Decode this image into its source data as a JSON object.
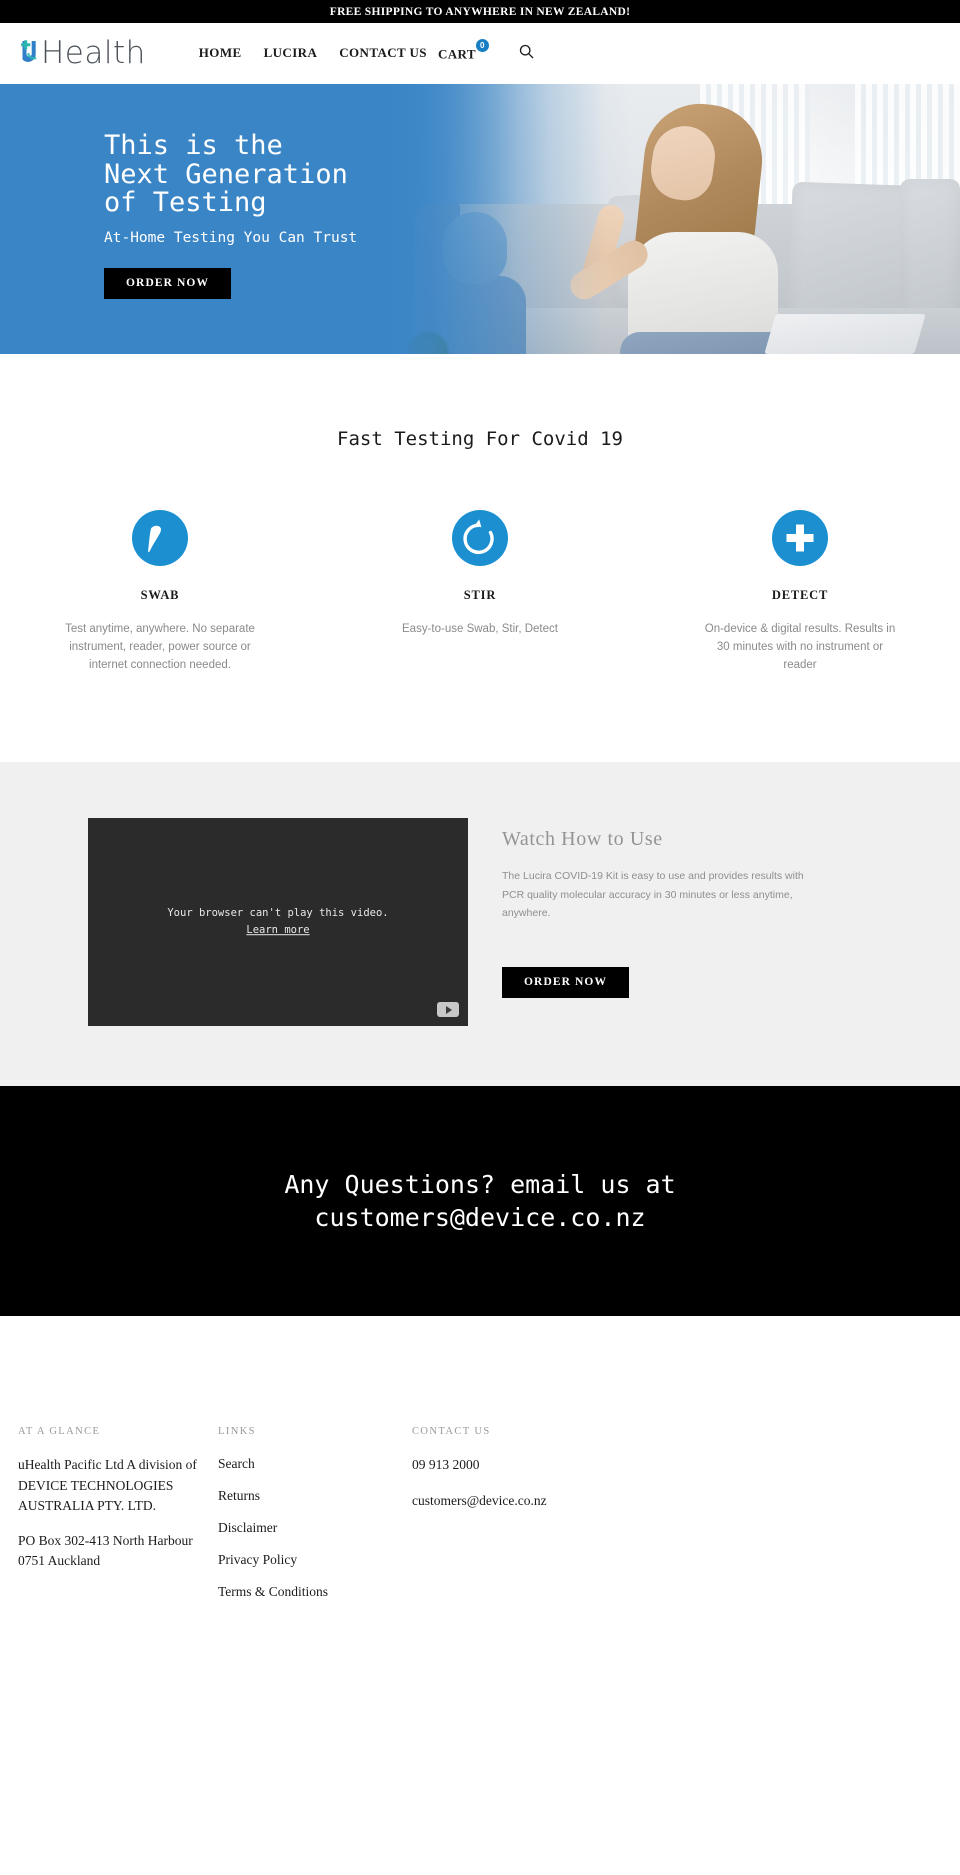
{
  "announcement": {
    "text": "FREE SHIPPING TO ANYWHERE IN NEW ZEALAND!"
  },
  "header": {
    "logo_text": "Health",
    "nav": [
      {
        "label": "HOME"
      },
      {
        "label": "LUCIRA"
      },
      {
        "label": "CONTACT US"
      }
    ],
    "cart_label": "CART",
    "cart_count": "0",
    "search_icon": "search-icon",
    "accent_color": "#1b7fc4"
  },
  "hero": {
    "title": "This is the Next Generation of Testing",
    "subtitle": "At-Home Testing You Can Trust",
    "cta_label": "ORDER NOW",
    "background_color": "#3a85c6"
  },
  "features": {
    "heading": "Fast Testing For Covid 19",
    "icon_color": "#1b8fd0",
    "items": [
      {
        "icon": "swab-icon",
        "title": "SWAB",
        "text": "Test anytime, anywhere. No separate instrument, reader, power source or internet connection needed."
      },
      {
        "icon": "stir-arrow-icon",
        "title": "STIR",
        "text": "Easy-to-use Swab, Stir, Detect"
      },
      {
        "icon": "plus-cross-icon",
        "title": "DETECT",
        "text": "On-device & digital results. Results in 30 minutes with no instrument or reader"
      }
    ]
  },
  "video_section": {
    "player_message": "Your browser can't play this video.",
    "player_link": "Learn more",
    "heading": "Watch How to Use",
    "body": "The Lucira COVID-19 Kit is easy to use and provides results with PCR quality molecular accuracy in 30 minutes or less anytime, anywhere.",
    "cta_label": "ORDER NOW"
  },
  "email_cta": {
    "line1": "Any Questions? email us at",
    "line2": "customers@device.co.nz"
  },
  "footer": {
    "columns": [
      {
        "heading": "AT A GLANCE",
        "paragraphs": [
          "uHealth Pacific Ltd A division of DEVICE TECHNOLOGIES AUSTRALIA PTY. LTD.",
          "PO Box 302-413 North Harbour 0751 Auckland"
        ]
      },
      {
        "heading": "LINKS",
        "links": [
          "Search",
          "Returns",
          "Disclaimer",
          "Privacy Policy",
          "Terms & Conditions"
        ]
      },
      {
        "heading": "CONTACT US",
        "phone": "09 913 2000",
        "email": "customers@device.co.nz"
      }
    ]
  }
}
